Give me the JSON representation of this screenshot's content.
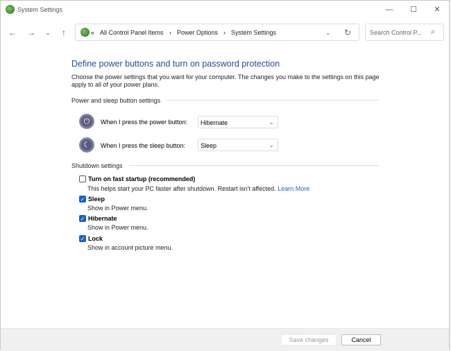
{
  "window": {
    "title": "System Settings",
    "minimize": "—",
    "maximize": "☐",
    "close": "✕"
  },
  "nav": {
    "back": "←",
    "forward": "→",
    "recent": "⌄",
    "up": "↑"
  },
  "address": {
    "overflow": "«",
    "crumbs": [
      "All Control Panel Items",
      "Power Options",
      "System Settings"
    ],
    "sep": "›",
    "dropdown": "⌄",
    "refresh": "↻"
  },
  "search": {
    "placeholder": "Search Control P...",
    "icon": "⌕"
  },
  "page": {
    "heading": "Define power buttons and turn on password protection",
    "description": "Choose the power settings that you want for your computer. The changes you make to the settings on this page apply to all of your power plans."
  },
  "power_section": {
    "title": "Power and sleep button settings",
    "power_label": "When I press the power button:",
    "power_value": "Hibernate",
    "sleep_label": "When I press the sleep button:",
    "sleep_value": "Sleep"
  },
  "shutdown_section": {
    "title": "Shutdown settings",
    "items": [
      {
        "label": "Turn on fast startup (recommended)",
        "desc": "This helps start your PC faster after shutdown. Restart isn't affected.",
        "link": "Learn More",
        "checked": false
      },
      {
        "label": "Sleep",
        "desc": "Show in Power menu.",
        "checked": true
      },
      {
        "label": "Hibernate",
        "desc": "Show in Power menu.",
        "checked": true
      },
      {
        "label": "Lock",
        "desc": "Show in account picture menu.",
        "checked": true
      }
    ]
  },
  "footer": {
    "save": "Save changes",
    "cancel": "Cancel"
  },
  "colors": {
    "accent": "#1763c6",
    "heading": "#1e4d9b"
  }
}
